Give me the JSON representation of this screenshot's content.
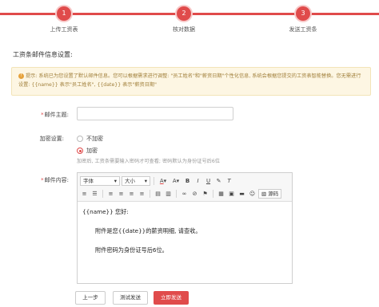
{
  "stepper": {
    "steps": [
      {
        "number": "1",
        "label": "上传工资表"
      },
      {
        "number": "2",
        "label": "核对数据"
      },
      {
        "number": "3",
        "label": "发送工资条"
      }
    ]
  },
  "section_title": "工资条邮件信息设置:",
  "notice": {
    "text": "提示: 系统已为您设置了默认邮件信息。您可以根据需求进行调整: \"员工姓名\"和\"薪资日期\"个性化信息, 系统会根据您提交的工资表智能替换。您无需进行设置: {{name}} 表示\"员工姓名\", {{date}} 表示\"薪资日期\""
  },
  "form": {
    "subject_label": "邮件主题:",
    "subject_value": "",
    "encrypt_label": "加密设置:",
    "encrypt_options": [
      "不加密",
      "加密"
    ],
    "encrypt_selected": "加密",
    "pwd_hint": "加密后, 工资条需要输入密码才可查看; 密码默认为身份证号后6位",
    "content_label": "邮件内容:"
  },
  "editor": {
    "font_family": "字体",
    "font_size": "大小",
    "source_label": "源码",
    "content": {
      "greeting": "{{name}} 您好:",
      "line1": "附件是您{{date}}的薪资明细, 请查收。",
      "line2": "附件密码为身份证号后6位。"
    }
  },
  "buttons": {
    "prev": "上一步",
    "test_send": "测试发送",
    "send_now": "立即发送"
  },
  "colors": {
    "accent": "#e04b4b",
    "notice_bg": "#fdf6e3"
  }
}
